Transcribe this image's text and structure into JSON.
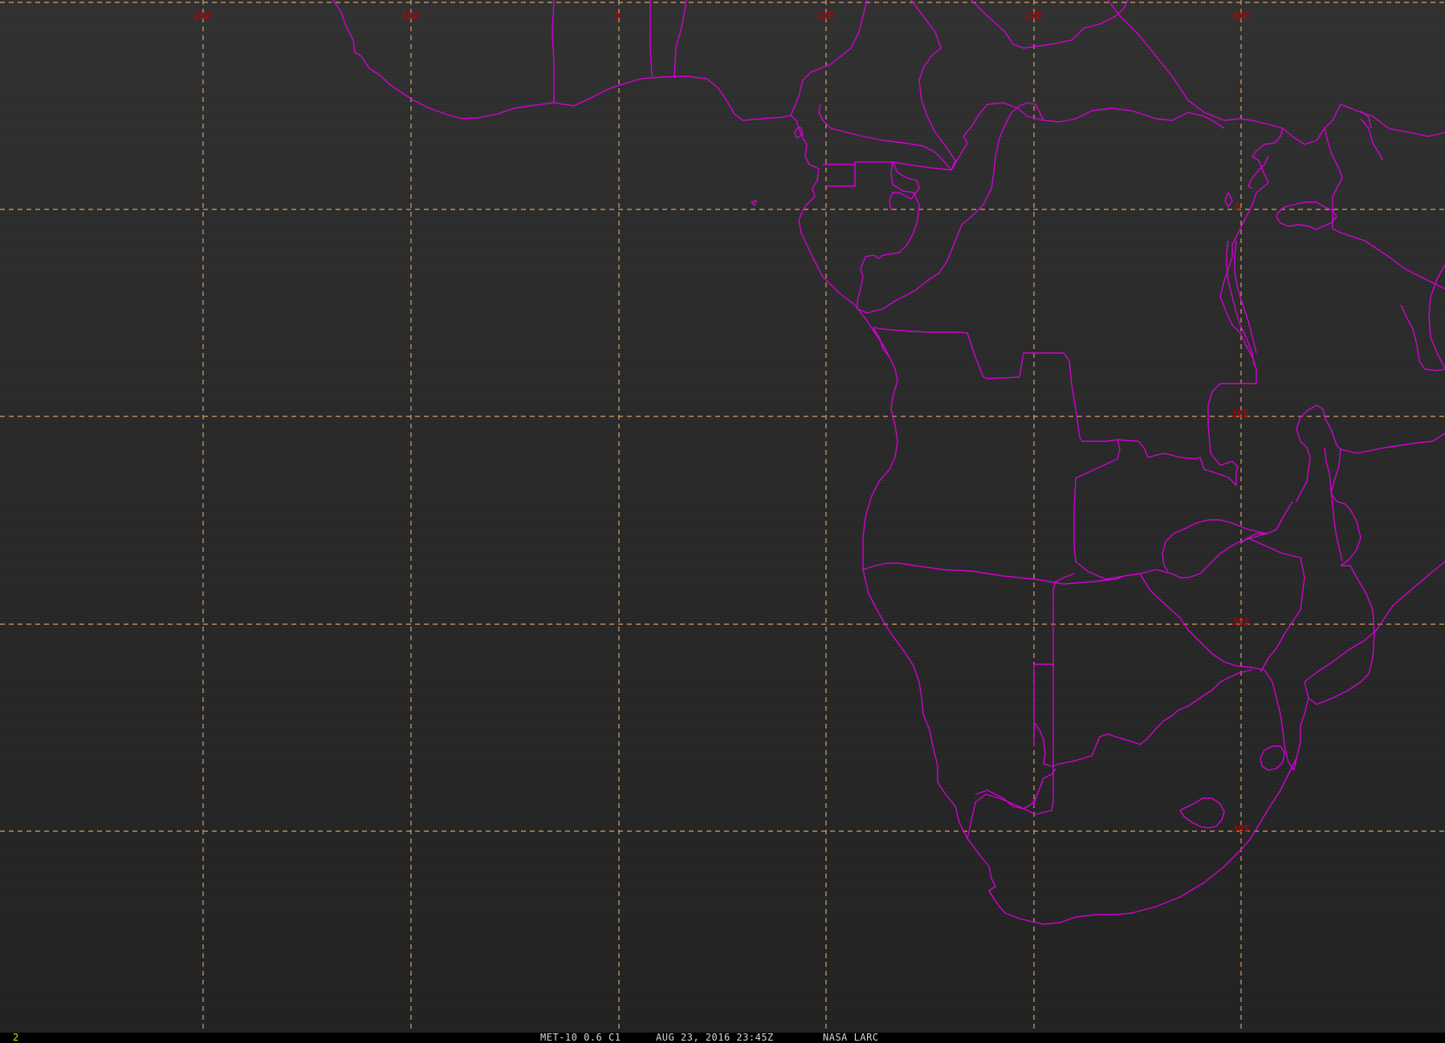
{
  "frame_number": "2",
  "caption": {
    "product": "MET-10 0.6 C1",
    "datetime": "AUG 23, 2016 23:45Z",
    "source": "NASA LARC"
  },
  "colors": {
    "background": "#2a2a2a",
    "border_lines": "#d400d4",
    "grid_lines": "#d9a06a",
    "grid_labels": "#c00000",
    "caption_text": "#d8d8d8",
    "frame_number": "#e8e000"
  },
  "grid": {
    "longitude_labels": [
      "20W",
      "10W",
      "0",
      "10E",
      "20E",
      "30E"
    ],
    "latitude_labels": [
      "0",
      "10S",
      "20S",
      "30S"
    ]
  }
}
